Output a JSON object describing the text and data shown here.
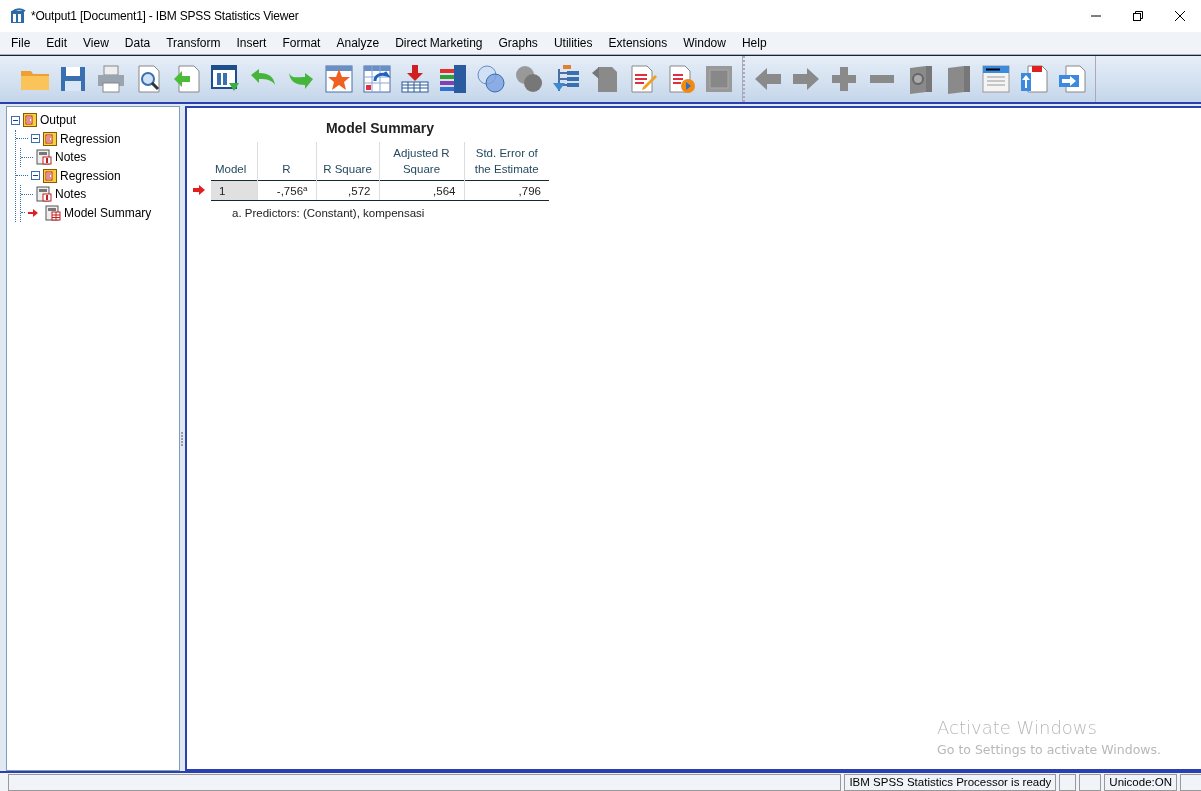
{
  "window": {
    "title": "*Output1 [Document1] - IBM SPSS Statistics Viewer"
  },
  "menu": [
    "File",
    "Edit",
    "View",
    "Data",
    "Transform",
    "Insert",
    "Format",
    "Analyze",
    "Direct Marketing",
    "Graphs",
    "Utilities",
    "Extensions",
    "Window",
    "Help"
  ],
  "outline": [
    {
      "label": "Output",
      "kind": "book",
      "expanded": true,
      "current": false,
      "children": [
        {
          "label": "Regression",
          "kind": "book",
          "expanded": true,
          "current": false,
          "children": [
            {
              "label": "Notes",
              "kind": "notes",
              "current": false
            }
          ]
        },
        {
          "label": "Regression",
          "kind": "book",
          "expanded": true,
          "current": false,
          "children": [
            {
              "label": "Notes",
              "kind": "notes",
              "current": false
            },
            {
              "label": "Model Summary",
              "kind": "table",
              "current": true
            }
          ]
        }
      ]
    }
  ],
  "table": {
    "title": "Model Summary",
    "columns": [
      "Model",
      "R",
      "R Square",
      "Adjusted R Square",
      "Std. Error of the Estimate"
    ],
    "rows": [
      [
        "1",
        "-,756$^{a}$",
        ",572",
        ",564",
        ",796"
      ]
    ],
    "footnote": "a. Predictors: (Constant), kompensasi"
  },
  "activation": {
    "title": "Activate Windows",
    "message": "Go to Settings to activate Windows."
  },
  "status_bar": {
    "message": "IBM SPSS Statistics Processor is ready",
    "unicode": "Unicode:ON"
  }
}
